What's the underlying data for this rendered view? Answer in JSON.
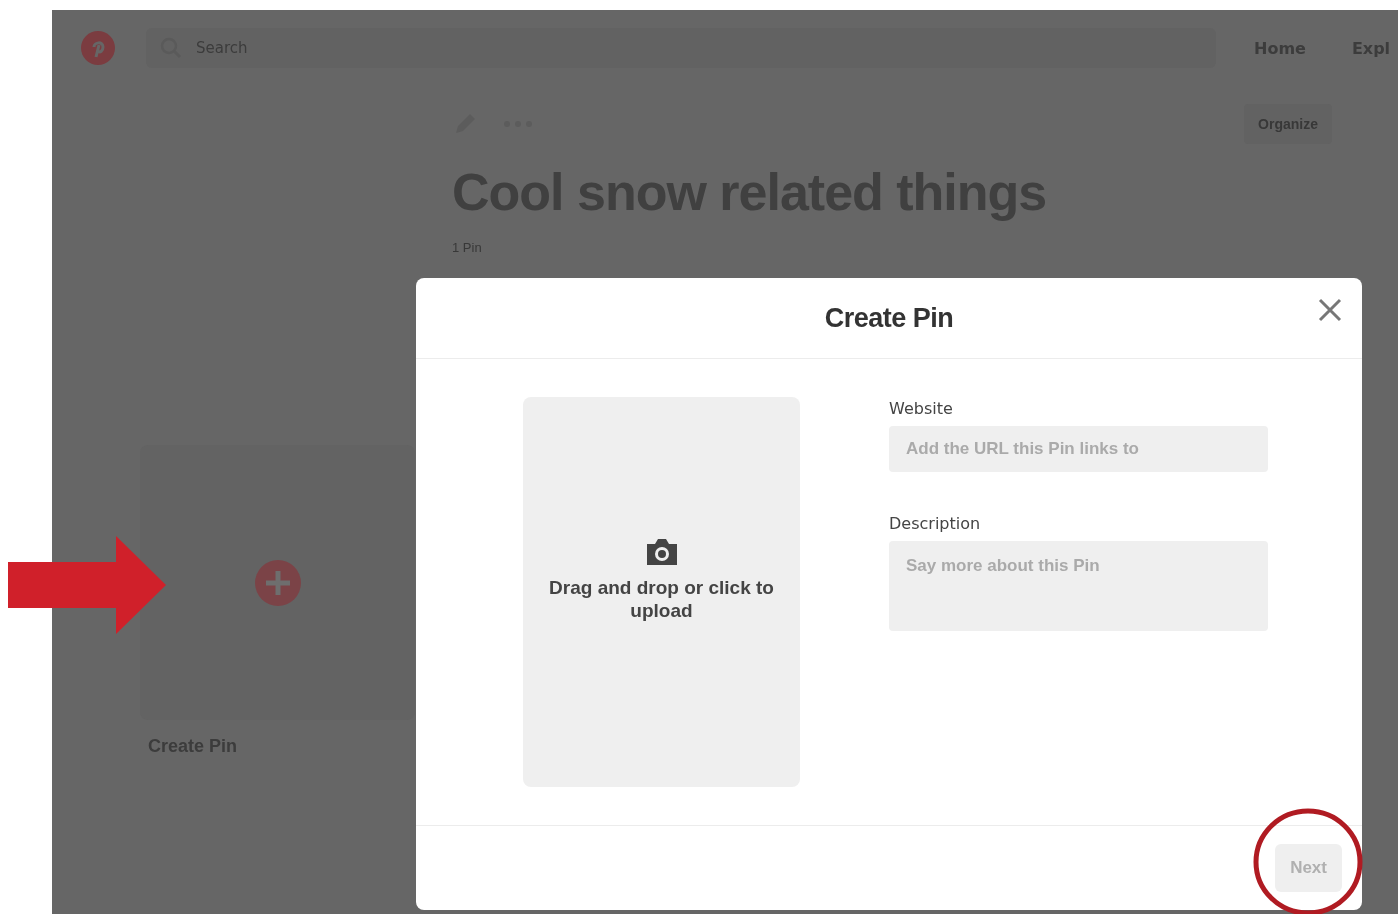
{
  "header": {
    "search": {
      "placeholder": "Search"
    },
    "nav": [
      "Home",
      "Expl"
    ]
  },
  "board": {
    "organize_button": "Organize",
    "title": "Cool snow related things",
    "pin_count": "1 Pin",
    "create_card_label": "Create Pin"
  },
  "dialog": {
    "title": "Create Pin",
    "upload_text": "Drag and drop or click to upload",
    "fields": [
      {
        "label": "Website",
        "placeholder": "Add the URL this Pin links to",
        "kind": "line"
      },
      {
        "label": "Description",
        "placeholder": "Say more about this Pin",
        "kind": "area"
      }
    ],
    "next_button": {
      "label": "Next",
      "disabled": true
    }
  }
}
